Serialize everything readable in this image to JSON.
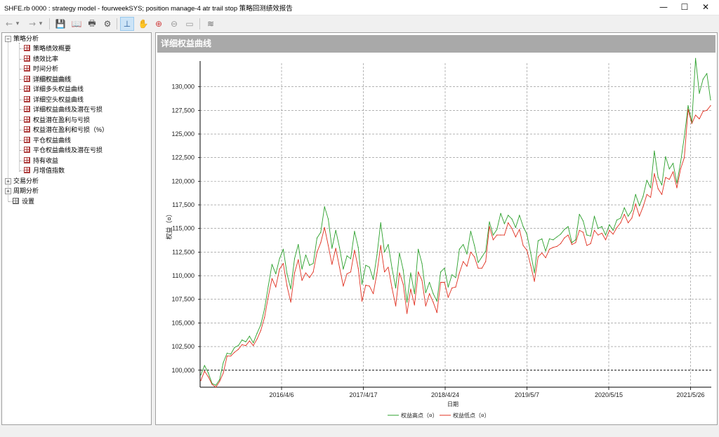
{
  "window": {
    "title": "SHFE.rb 0000 : strategy model -  fourweekSYS; position manage-4 atr trail stop 策略回测绩效报告",
    "min_glyph": "—",
    "max_glyph": "☐",
    "close_glyph": "✕"
  },
  "toolbar": {
    "back_glyph": "←",
    "back_drop": "▾",
    "forward_glyph": "→",
    "forward_drop": "▾",
    "save_glyph": "💾",
    "open_glyph": "📖",
    "print_glyph": "🖶",
    "settings_glyph": "⚙",
    "cursor_glyph": "⊥",
    "pan_glyph": "✋",
    "zoom_in_glyph": "⊕",
    "zoom_out_glyph": "⊖",
    "fit_glyph": "▭",
    "export_glyph": "≋"
  },
  "tree": {
    "root": {
      "label": "策略分析",
      "expander": "−"
    },
    "children": [
      {
        "label": "策略绩效概要"
      },
      {
        "label": "绩效比率"
      },
      {
        "label": "时间分析"
      },
      {
        "label": "详细权益曲线",
        "selected": true
      },
      {
        "label": "详细多头权益曲线"
      },
      {
        "label": "详细空头权益曲线"
      },
      {
        "label": "详细权益曲线及潜在亏损"
      },
      {
        "label": "权益潜在盈利与亏损"
      },
      {
        "label": "权益潜在盈利和亏损（%）"
      },
      {
        "label": "平仓权益曲线"
      },
      {
        "label": "平仓权益曲线及潜在亏损"
      },
      {
        "label": "持有收益"
      },
      {
        "label": "月增值指数"
      }
    ],
    "others": [
      {
        "label": "交易分析",
        "expander": "+"
      },
      {
        "label": "周期分析",
        "expander": "+"
      }
    ],
    "settings": {
      "label": "设置"
    }
  },
  "panel": {
    "header": "详细权益曲线"
  },
  "chart_data": {
    "type": "line",
    "title": "",
    "xlabel": "日期",
    "ylabel": "权益（¤）",
    "ylim": [
      98200,
      132500
    ],
    "y_ticks": [
      "100,000",
      "102,500",
      "105,000",
      "107,500",
      "110,000",
      "112,500",
      "115,000",
      "117,500",
      "120,000",
      "122,500",
      "125,000",
      "127,500",
      "130,000"
    ],
    "y_tick_values": [
      100000,
      102500,
      105000,
      107500,
      110000,
      112500,
      115000,
      117500,
      120000,
      122500,
      125000,
      127500,
      130000
    ],
    "x_tick_labels": [
      "2016/4/6",
      "2017/4/17",
      "2018/4/24",
      "2019/5/7",
      "2020/5/15",
      "2021/5/26"
    ],
    "grid": true,
    "legend_position": "bottom",
    "colors": {
      "high": "#2ca02c",
      "low": "#e03020"
    },
    "series": [
      {
        "name": "权益高点（¤）",
        "values": [
          99500,
          100500,
          99700,
          98600,
          98400,
          99000,
          100800,
          101800,
          101700,
          102400,
          102600,
          103200,
          103000,
          103600,
          102900,
          103900,
          104800,
          106500,
          108900,
          111200,
          110200,
          111800,
          112800,
          110200,
          108600,
          111800,
          113300,
          110700,
          112200,
          111100,
          111300,
          114000,
          114600,
          117300,
          116000,
          112900,
          114800,
          113000,
          110700,
          112100,
          111800,
          114700,
          113000,
          109100,
          111100,
          110900,
          109600,
          112200,
          115600,
          112500,
          113300,
          110800,
          108700,
          112400,
          110600,
          107200,
          110300,
          108100,
          112800,
          111300,
          108200,
          109300,
          108100,
          107300,
          110400,
          110800,
          108800,
          110100,
          109800,
          112800,
          113300,
          112300,
          114700,
          113200,
          111400,
          112000,
          112600,
          115700,
          114300,
          114900,
          116600,
          115500,
          116400,
          116000,
          115100,
          116400,
          115200,
          114400,
          112400,
          110300,
          113700,
          113900,
          112600,
          113900,
          113800,
          114100,
          114400,
          114900,
          115200,
          113500,
          113800,
          116500,
          115800,
          114300,
          114200,
          116300,
          115000,
          115200,
          114300,
          115400,
          114800,
          115900,
          116100,
          117200,
          116300,
          116900,
          118600,
          117400,
          118400,
          120100,
          119300,
          123200,
          120400,
          119600,
          122600,
          121300,
          121900,
          119800,
          122000,
          124700,
          128000,
          126200,
          133000,
          129300,
          130800,
          131400,
          128600
        ],
        "cutoff": 121
      },
      {
        "name": "权益低点（¤）",
        "values": [
          98900,
          99900,
          99300,
          98500,
          98200,
          98800,
          99700,
          101500,
          101500,
          101900,
          102200,
          102700,
          102600,
          103100,
          102600,
          103300,
          104200,
          105600,
          107800,
          109700,
          108800,
          110700,
          111300,
          108900,
          107200,
          110300,
          111700,
          109500,
          110300,
          109800,
          110400,
          112500,
          113500,
          115100,
          113200,
          111200,
          112900,
          110900,
          108900,
          110200,
          110400,
          112700,
          110800,
          107300,
          109000,
          108900,
          108100,
          110300,
          113200,
          110400,
          110900,
          108700,
          106800,
          110300,
          109100,
          106000,
          108600,
          106900,
          110400,
          109500,
          106800,
          108100,
          107200,
          106100,
          109300,
          109300,
          107700,
          108700,
          108800,
          110300,
          111500,
          111000,
          112500,
          112000,
          110800,
          110800,
          111500,
          115200,
          113800,
          114300,
          114300,
          114300,
          115600,
          115000,
          114100,
          114900,
          113200,
          112700,
          111100,
          109400,
          112000,
          112400,
          111900,
          112800,
          113000,
          113100,
          113400,
          114000,
          114300,
          113300,
          113500,
          114800,
          114600,
          113200,
          113400,
          114800,
          114300,
          114500,
          113800,
          114800,
          114400,
          115100,
          115600,
          116500,
          115600,
          116100,
          117600,
          116300,
          117300,
          118600,
          118300,
          120800,
          119200,
          118600,
          120400,
          120200,
          121000,
          119300,
          121300,
          122500,
          127600,
          126100,
          127000,
          126600,
          127400,
          127500,
          128000
        ],
        "cutoff": 121
      }
    ]
  }
}
